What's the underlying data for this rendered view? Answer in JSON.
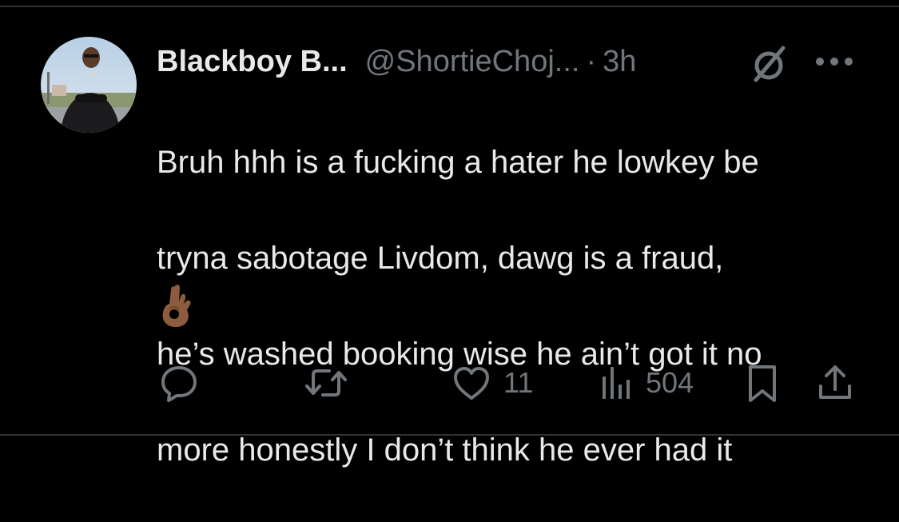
{
  "tweet": {
    "author": {
      "display_name": "Blackboy B...",
      "handle": "@ShortieChoj...",
      "avatar_icon": "profile-photo"
    },
    "separator": "·",
    "time_ago": "3h",
    "text_lines": [
      "Bruh hhh is a fucking a hater he lowkey be",
      "tryna sabotage Livdom, dawg is a fraud,",
      "he’s washed booking wise he ain’t got it no",
      "more honestly I don’t think he ever had it"
    ],
    "emoji": "👌🏾",
    "header_icons": [
      "grok-icon",
      "more-icon"
    ],
    "actions": {
      "reply": {
        "icon": "reply-icon",
        "count": ""
      },
      "retweet": {
        "icon": "retweet-icon",
        "count": ""
      },
      "like": {
        "icon": "heart-icon",
        "count": "11"
      },
      "views": {
        "icon": "views-icon",
        "count": "504"
      },
      "bookmark": {
        "icon": "bookmark-icon"
      },
      "share": {
        "icon": "share-icon"
      }
    }
  },
  "colors": {
    "background": "#000000",
    "primary_text": "#e7e9ea",
    "secondary_text": "#71767b",
    "divider": "#2f3336"
  }
}
